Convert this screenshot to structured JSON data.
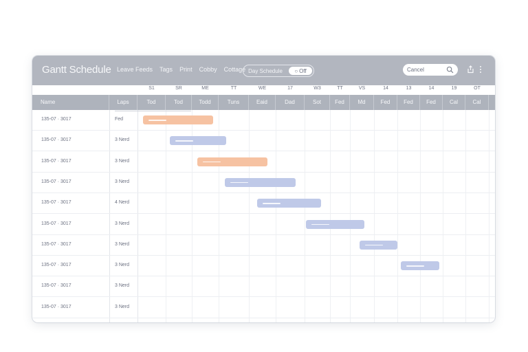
{
  "app": {
    "title": "Gantt Schedule"
  },
  "menu": [
    "Leave Feeds",
    "Tags",
    "Print",
    "Cobby",
    "Cottage"
  ],
  "view_toggle": {
    "left": "Day Schedule",
    "right": "Off"
  },
  "search": {
    "value": "Cancel"
  },
  "day_labels": [
    "S1",
    "SR",
    "ME",
    "TT",
    "WE",
    "17",
    "W3",
    "TT",
    "VS",
    "14",
    "13",
    "14",
    "19",
    "OT"
  ],
  "columns": {
    "name": "Name",
    "duration": "Laps",
    "days": [
      "Tod",
      "Tod",
      "Todd",
      "Tuns",
      "Eaid",
      "Dad",
      "Sot",
      "Fed",
      "Md",
      "Fed",
      "Fed",
      "Fed",
      "Cal",
      "Cal"
    ]
  },
  "tasks": [
    {
      "name": "135-07 · 3017",
      "duration": "Fed",
      "start": 0.2,
      "end": 2.8,
      "color": "#f6c2a2"
    },
    {
      "name": "135-07 · 3017",
      "duration": "3 Nerd",
      "start": 1.15,
      "end": 3.25,
      "color": "#bfc9e8"
    },
    {
      "name": "135-07 · 3017",
      "duration": "3 Nerd",
      "start": 2.2,
      "end": 4.7,
      "color": "#f6c2a2"
    },
    {
      "name": "135-07 · 3017",
      "duration": "3 Nerd",
      "start": 3.2,
      "end": 5.7,
      "color": "#bfc9e8"
    },
    {
      "name": "135-07 · 3017",
      "duration": "4 Nerd",
      "start": 4.3,
      "end": 6.65,
      "color": "#bfc9e8"
    },
    {
      "name": "135-07 · 3017",
      "duration": "3 Nerd",
      "start": 6.05,
      "end": 8.6,
      "color": "#bfc9e8"
    },
    {
      "name": "135-07 · 3017",
      "duration": "3 Nerd",
      "start": 8.4,
      "end": 10.0,
      "color": "#bfc9e8"
    },
    {
      "name": "135-07 · 3017",
      "duration": "3 Nerd",
      "start": 10.15,
      "end": 11.85,
      "color": "#bfc9e8"
    },
    {
      "name": "135-07 · 3017",
      "duration": "3 Nerd"
    },
    {
      "name": "135-07 · 3017",
      "duration": "3 Nerd"
    }
  ],
  "colors": {
    "toolbar": "#b2b6bf",
    "header": "#aeb3bc",
    "bar_peach": "#f6c2a2",
    "bar_blue": "#bfc9e8"
  }
}
